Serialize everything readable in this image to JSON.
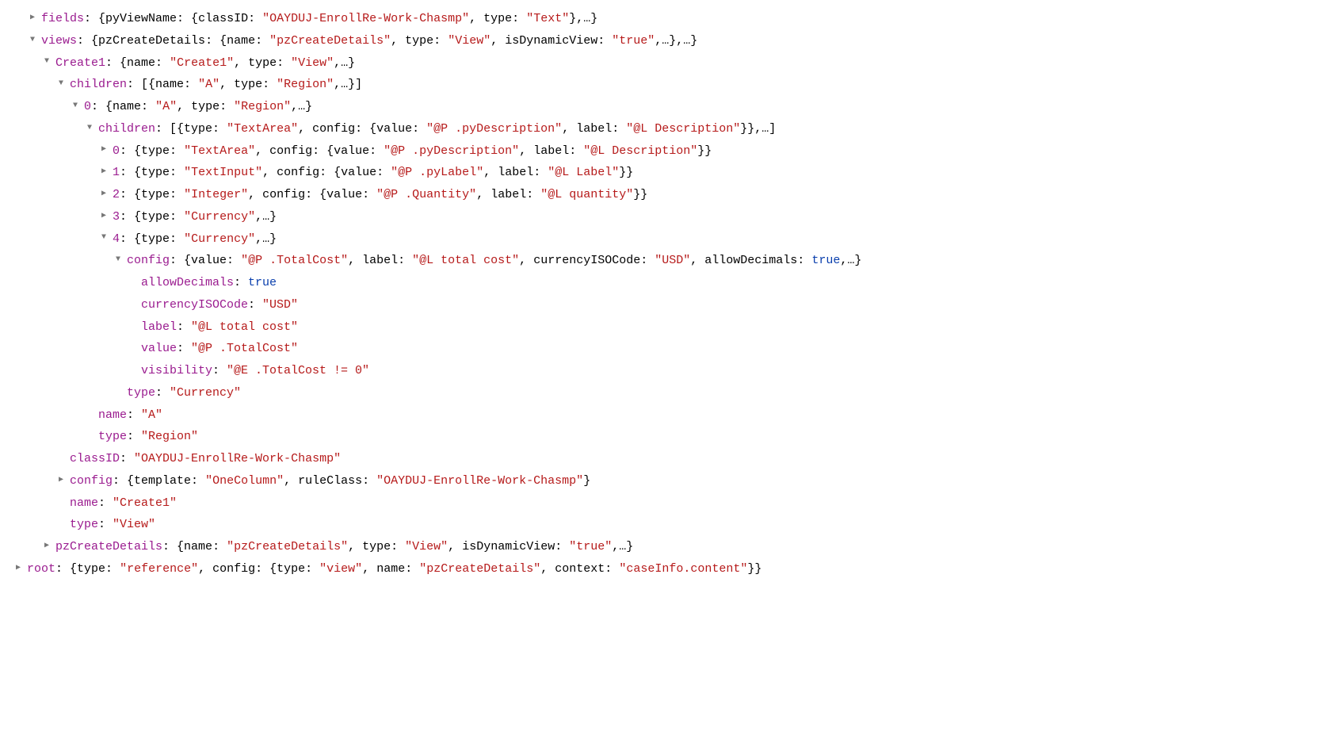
{
  "rows": [
    {
      "indent": 1,
      "arrow": "right",
      "parts": [
        [
          "key",
          "fields"
        ],
        [
          "punct",
          ": {"
        ],
        [
          "plain",
          "pyViewName"
        ],
        [
          "punct",
          ": {"
        ],
        [
          "plain",
          "classID"
        ],
        [
          "punct",
          ": "
        ],
        [
          "str",
          "\"OAYDUJ-EnrollRe-Work-Chasmp\""
        ],
        [
          "punct",
          ", "
        ],
        [
          "plain",
          "type"
        ],
        [
          "punct",
          ": "
        ],
        [
          "str",
          "\"Text\""
        ],
        [
          "punct",
          "},…}"
        ]
      ]
    },
    {
      "indent": 1,
      "arrow": "down",
      "parts": [
        [
          "key",
          "views"
        ],
        [
          "punct",
          ": {"
        ],
        [
          "plain",
          "pzCreateDetails"
        ],
        [
          "punct",
          ": {"
        ],
        [
          "plain",
          "name"
        ],
        [
          "punct",
          ": "
        ],
        [
          "str",
          "\"pzCreateDetails\""
        ],
        [
          "punct",
          ", "
        ],
        [
          "plain",
          "type"
        ],
        [
          "punct",
          ": "
        ],
        [
          "str",
          "\"View\""
        ],
        [
          "punct",
          ", "
        ],
        [
          "plain",
          "isDynamicView"
        ],
        [
          "punct",
          ": "
        ],
        [
          "str",
          "\"true\""
        ],
        [
          "punct",
          ",…},…}"
        ]
      ]
    },
    {
      "indent": 2,
      "arrow": "down",
      "parts": [
        [
          "key",
          "Create1"
        ],
        [
          "punct",
          ": {"
        ],
        [
          "plain",
          "name"
        ],
        [
          "punct",
          ": "
        ],
        [
          "str",
          "\"Create1\""
        ],
        [
          "punct",
          ", "
        ],
        [
          "plain",
          "type"
        ],
        [
          "punct",
          ": "
        ],
        [
          "str",
          "\"View\""
        ],
        [
          "punct",
          ",…}"
        ]
      ]
    },
    {
      "indent": 3,
      "arrow": "down",
      "parts": [
        [
          "key",
          "children"
        ],
        [
          "punct",
          ": [{"
        ],
        [
          "plain",
          "name"
        ],
        [
          "punct",
          ": "
        ],
        [
          "str",
          "\"A\""
        ],
        [
          "punct",
          ", "
        ],
        [
          "plain",
          "type"
        ],
        [
          "punct",
          ": "
        ],
        [
          "str",
          "\"Region\""
        ],
        [
          "punct",
          ",…}]"
        ]
      ]
    },
    {
      "indent": 4,
      "arrow": "down",
      "parts": [
        [
          "key",
          "0"
        ],
        [
          "punct",
          ": {"
        ],
        [
          "plain",
          "name"
        ],
        [
          "punct",
          ": "
        ],
        [
          "str",
          "\"A\""
        ],
        [
          "punct",
          ", "
        ],
        [
          "plain",
          "type"
        ],
        [
          "punct",
          ": "
        ],
        [
          "str",
          "\"Region\""
        ],
        [
          "punct",
          ",…}"
        ]
      ]
    },
    {
      "indent": 5,
      "arrow": "down",
      "parts": [
        [
          "key",
          "children"
        ],
        [
          "punct",
          ": [{"
        ],
        [
          "plain",
          "type"
        ],
        [
          "punct",
          ": "
        ],
        [
          "str",
          "\"TextArea\""
        ],
        [
          "punct",
          ", "
        ],
        [
          "plain",
          "config"
        ],
        [
          "punct",
          ": {"
        ],
        [
          "plain",
          "value"
        ],
        [
          "punct",
          ": "
        ],
        [
          "str",
          "\"@P .pyDescription\""
        ],
        [
          "punct",
          ", "
        ],
        [
          "plain",
          "label"
        ],
        [
          "punct",
          ": "
        ],
        [
          "str",
          "\"@L Description\""
        ],
        [
          "punct",
          "}},…]"
        ]
      ]
    },
    {
      "indent": 6,
      "arrow": "right",
      "parts": [
        [
          "key",
          "0"
        ],
        [
          "punct",
          ": {"
        ],
        [
          "plain",
          "type"
        ],
        [
          "punct",
          ": "
        ],
        [
          "str",
          "\"TextArea\""
        ],
        [
          "punct",
          ", "
        ],
        [
          "plain",
          "config"
        ],
        [
          "punct",
          ": {"
        ],
        [
          "plain",
          "value"
        ],
        [
          "punct",
          ": "
        ],
        [
          "str",
          "\"@P .pyDescription\""
        ],
        [
          "punct",
          ", "
        ],
        [
          "plain",
          "label"
        ],
        [
          "punct",
          ": "
        ],
        [
          "str",
          "\"@L Description\""
        ],
        [
          "punct",
          "}}"
        ]
      ]
    },
    {
      "indent": 6,
      "arrow": "right",
      "parts": [
        [
          "key",
          "1"
        ],
        [
          "punct",
          ": {"
        ],
        [
          "plain",
          "type"
        ],
        [
          "punct",
          ": "
        ],
        [
          "str",
          "\"TextInput\""
        ],
        [
          "punct",
          ", "
        ],
        [
          "plain",
          "config"
        ],
        [
          "punct",
          ": {"
        ],
        [
          "plain",
          "value"
        ],
        [
          "punct",
          ": "
        ],
        [
          "str",
          "\"@P .pyLabel\""
        ],
        [
          "punct",
          ", "
        ],
        [
          "plain",
          "label"
        ],
        [
          "punct",
          ": "
        ],
        [
          "str",
          "\"@L Label\""
        ],
        [
          "punct",
          "}}"
        ]
      ]
    },
    {
      "indent": 6,
      "arrow": "right",
      "parts": [
        [
          "key",
          "2"
        ],
        [
          "punct",
          ": {"
        ],
        [
          "plain",
          "type"
        ],
        [
          "punct",
          ": "
        ],
        [
          "str",
          "\"Integer\""
        ],
        [
          "punct",
          ", "
        ],
        [
          "plain",
          "config"
        ],
        [
          "punct",
          ": {"
        ],
        [
          "plain",
          "value"
        ],
        [
          "punct",
          ": "
        ],
        [
          "str",
          "\"@P .Quantity\""
        ],
        [
          "punct",
          ", "
        ],
        [
          "plain",
          "label"
        ],
        [
          "punct",
          ": "
        ],
        [
          "str",
          "\"@L quantity\""
        ],
        [
          "punct",
          "}}"
        ]
      ]
    },
    {
      "indent": 6,
      "arrow": "right",
      "parts": [
        [
          "key",
          "3"
        ],
        [
          "punct",
          ": {"
        ],
        [
          "plain",
          "type"
        ],
        [
          "punct",
          ": "
        ],
        [
          "str",
          "\"Currency\""
        ],
        [
          "punct",
          ",…}"
        ]
      ]
    },
    {
      "indent": 6,
      "arrow": "down",
      "parts": [
        [
          "key",
          "4"
        ],
        [
          "punct",
          ": {"
        ],
        [
          "plain",
          "type"
        ],
        [
          "punct",
          ": "
        ],
        [
          "str",
          "\"Currency\""
        ],
        [
          "punct",
          ",…}"
        ]
      ]
    },
    {
      "indent": 7,
      "arrow": "down",
      "parts": [
        [
          "key",
          "config"
        ],
        [
          "punct",
          ": {"
        ],
        [
          "plain",
          "value"
        ],
        [
          "punct",
          ": "
        ],
        [
          "str",
          "\"@P .TotalCost\""
        ],
        [
          "punct",
          ", "
        ],
        [
          "plain",
          "label"
        ],
        [
          "punct",
          ": "
        ],
        [
          "str",
          "\"@L total cost\""
        ],
        [
          "punct",
          ", "
        ],
        [
          "plain",
          "currencyISOCode"
        ],
        [
          "punct",
          ": "
        ],
        [
          "str",
          "\"USD\""
        ],
        [
          "punct",
          ", "
        ],
        [
          "plain",
          "allowDecimals"
        ],
        [
          "punct",
          ": "
        ],
        [
          "bool",
          "true"
        ],
        [
          "punct",
          ",…}"
        ]
      ]
    },
    {
      "indent": 8,
      "arrow": "none",
      "parts": [
        [
          "key",
          "allowDecimals"
        ],
        [
          "punct",
          ": "
        ],
        [
          "bool",
          "true"
        ]
      ]
    },
    {
      "indent": 8,
      "arrow": "none",
      "parts": [
        [
          "key",
          "currencyISOCode"
        ],
        [
          "punct",
          ": "
        ],
        [
          "str",
          "\"USD\""
        ]
      ]
    },
    {
      "indent": 8,
      "arrow": "none",
      "parts": [
        [
          "key",
          "label"
        ],
        [
          "punct",
          ": "
        ],
        [
          "str",
          "\"@L total cost\""
        ]
      ]
    },
    {
      "indent": 8,
      "arrow": "none",
      "parts": [
        [
          "key",
          "value"
        ],
        [
          "punct",
          ": "
        ],
        [
          "str",
          "\"@P .TotalCost\""
        ]
      ]
    },
    {
      "indent": 8,
      "arrow": "none",
      "parts": [
        [
          "key",
          "visibility"
        ],
        [
          "punct",
          ": "
        ],
        [
          "str",
          "\"@E .TotalCost != 0\""
        ]
      ]
    },
    {
      "indent": 7,
      "arrow": "none",
      "parts": [
        [
          "key",
          "type"
        ],
        [
          "punct",
          ": "
        ],
        [
          "str",
          "\"Currency\""
        ]
      ]
    },
    {
      "indent": 5,
      "arrow": "none",
      "parts": [
        [
          "key",
          "name"
        ],
        [
          "punct",
          ": "
        ],
        [
          "str",
          "\"A\""
        ]
      ]
    },
    {
      "indent": 5,
      "arrow": "none",
      "parts": [
        [
          "key",
          "type"
        ],
        [
          "punct",
          ": "
        ],
        [
          "str",
          "\"Region\""
        ]
      ]
    },
    {
      "indent": 3,
      "arrow": "none",
      "parts": [
        [
          "key",
          "classID"
        ],
        [
          "punct",
          ": "
        ],
        [
          "str",
          "\"OAYDUJ-EnrollRe-Work-Chasmp\""
        ]
      ]
    },
    {
      "indent": 3,
      "arrow": "right",
      "parts": [
        [
          "key",
          "config"
        ],
        [
          "punct",
          ": {"
        ],
        [
          "plain",
          "template"
        ],
        [
          "punct",
          ": "
        ],
        [
          "str",
          "\"OneColumn\""
        ],
        [
          "punct",
          ", "
        ],
        [
          "plain",
          "ruleClass"
        ],
        [
          "punct",
          ": "
        ],
        [
          "str",
          "\"OAYDUJ-EnrollRe-Work-Chasmp\""
        ],
        [
          "punct",
          "}"
        ]
      ]
    },
    {
      "indent": 3,
      "arrow": "none",
      "parts": [
        [
          "key",
          "name"
        ],
        [
          "punct",
          ": "
        ],
        [
          "str",
          "\"Create1\""
        ]
      ]
    },
    {
      "indent": 3,
      "arrow": "none",
      "parts": [
        [
          "key",
          "type"
        ],
        [
          "punct",
          ": "
        ],
        [
          "str",
          "\"View\""
        ]
      ]
    },
    {
      "indent": 2,
      "arrow": "right",
      "parts": [
        [
          "key",
          "pzCreateDetails"
        ],
        [
          "punct",
          ": {"
        ],
        [
          "plain",
          "name"
        ],
        [
          "punct",
          ": "
        ],
        [
          "str",
          "\"pzCreateDetails\""
        ],
        [
          "punct",
          ", "
        ],
        [
          "plain",
          "type"
        ],
        [
          "punct",
          ": "
        ],
        [
          "str",
          "\"View\""
        ],
        [
          "punct",
          ", "
        ],
        [
          "plain",
          "isDynamicView"
        ],
        [
          "punct",
          ": "
        ],
        [
          "str",
          "\"true\""
        ],
        [
          "punct",
          ",…}"
        ]
      ]
    },
    {
      "indent": 0,
      "arrow": "right",
      "parts": [
        [
          "key",
          "root"
        ],
        [
          "punct",
          ": {"
        ],
        [
          "plain",
          "type"
        ],
        [
          "punct",
          ": "
        ],
        [
          "str",
          "\"reference\""
        ],
        [
          "punct",
          ", "
        ],
        [
          "plain",
          "config"
        ],
        [
          "punct",
          ": {"
        ],
        [
          "plain",
          "type"
        ],
        [
          "punct",
          ": "
        ],
        [
          "str",
          "\"view\""
        ],
        [
          "punct",
          ", "
        ],
        [
          "plain",
          "name"
        ],
        [
          "punct",
          ": "
        ],
        [
          "str",
          "\"pzCreateDetails\""
        ],
        [
          "punct",
          ", "
        ],
        [
          "plain",
          "context"
        ],
        [
          "punct",
          ": "
        ],
        [
          "str",
          "\"caseInfo.content\""
        ],
        [
          "punct",
          "}}"
        ]
      ]
    }
  ]
}
